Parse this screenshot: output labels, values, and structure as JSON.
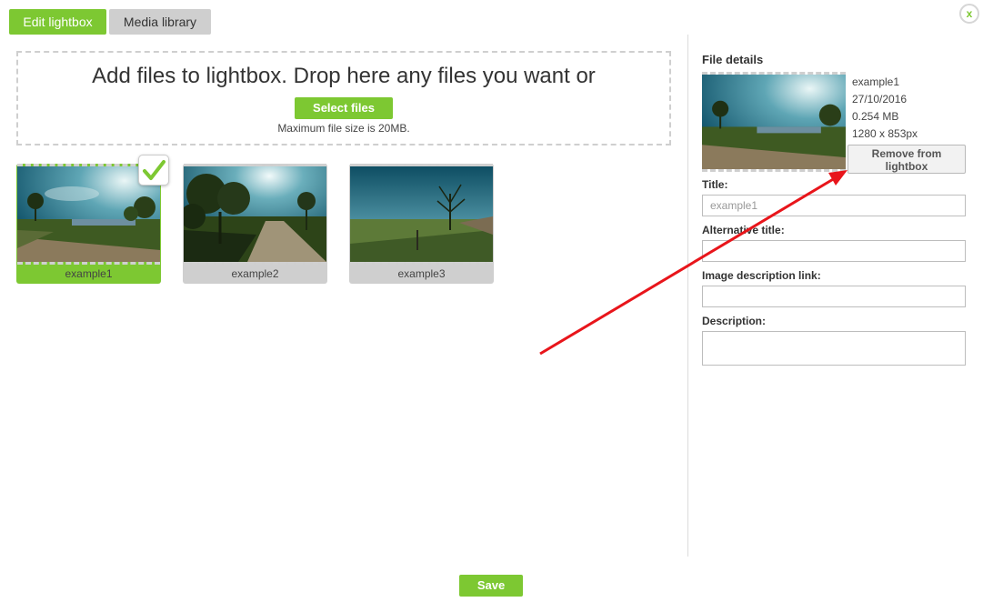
{
  "tabs": [
    {
      "label": "Edit lightbox",
      "active": true
    },
    {
      "label": "Media library",
      "active": false
    }
  ],
  "close_label": "x",
  "dropzone": {
    "title": "Add files to lightbox. Drop here any files you want or",
    "select_button": "Select files",
    "max_size": "Maximum file size is 20MB."
  },
  "thumbnails": [
    {
      "caption": "example1",
      "selected": true
    },
    {
      "caption": "example2",
      "selected": false
    },
    {
      "caption": "example3",
      "selected": false
    }
  ],
  "file_details": {
    "title": "File details",
    "name": "example1",
    "date": "27/10/2016",
    "size": "0.254 MB",
    "dimensions": "1280 x 853px",
    "remove_button_line1": "Remove from",
    "remove_button_line2": "lightbox"
  },
  "fields": {
    "title_label": "Title:",
    "title_placeholder": "example1",
    "alt_label": "Alternative title:",
    "link_label": "Image description link:",
    "description_label": "Description:"
  },
  "save_label": "Save",
  "colors": {
    "accent": "#7dc832",
    "inactive": "#cfcfcf",
    "annotation_arrow": "#e8151b"
  }
}
